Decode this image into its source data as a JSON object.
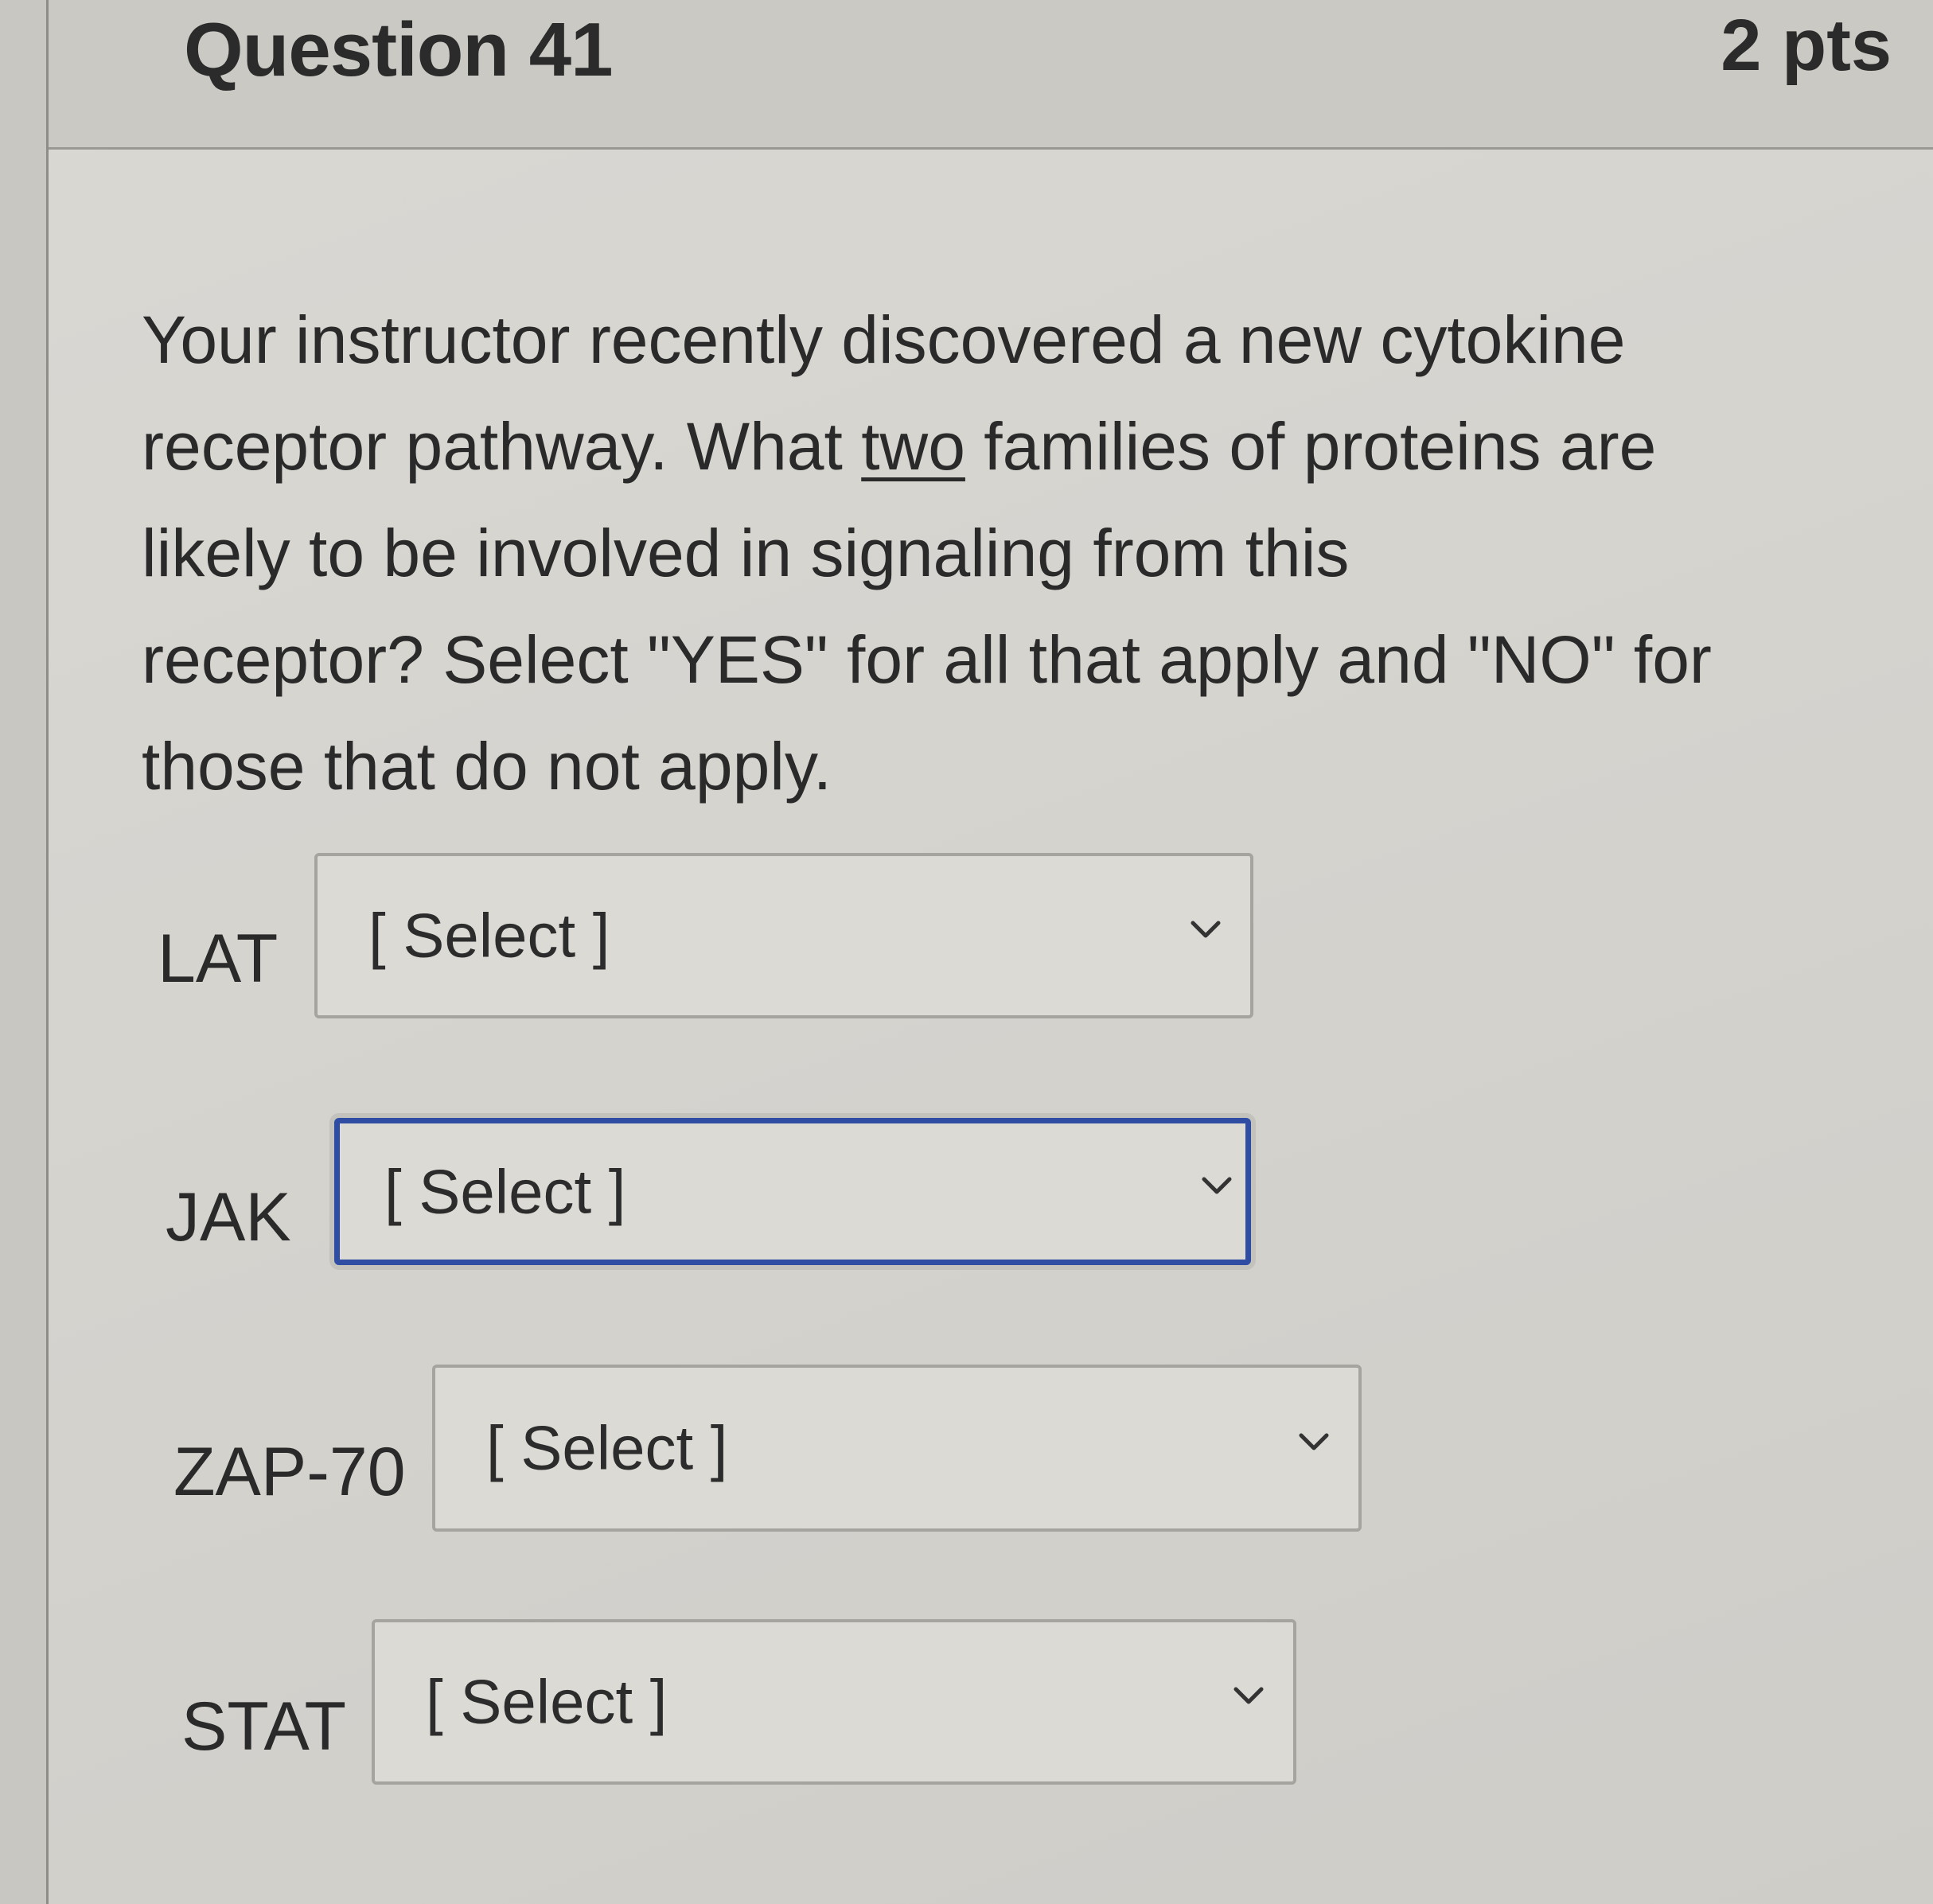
{
  "header": {
    "title": "Question 41",
    "points": "2 pts"
  },
  "question": {
    "line1": "Your instructor recently discovered a new cytokine",
    "line2_before": "receptor pathway. What ",
    "line2_underlined": "two",
    "line2_after": " families of proteins are",
    "line3": "likely to be involved in signaling from this",
    "line4": "receptor? Select \"YES\" for all that apply and \"NO\" for",
    "line5": "those that do not apply."
  },
  "rows": [
    {
      "label": "LAT",
      "value": "[ Select ]",
      "icon": "chevron-down-icon"
    },
    {
      "label": "JAK",
      "value": "[ Select ]",
      "icon": "chevron-down-icon",
      "focused": true
    },
    {
      "label": "ZAP-70",
      "value": "[ Select ]",
      "icon": "chevron-down-icon"
    },
    {
      "label": "STAT",
      "value": "[ Select ]",
      "icon": "chevron-down-icon"
    }
  ]
}
